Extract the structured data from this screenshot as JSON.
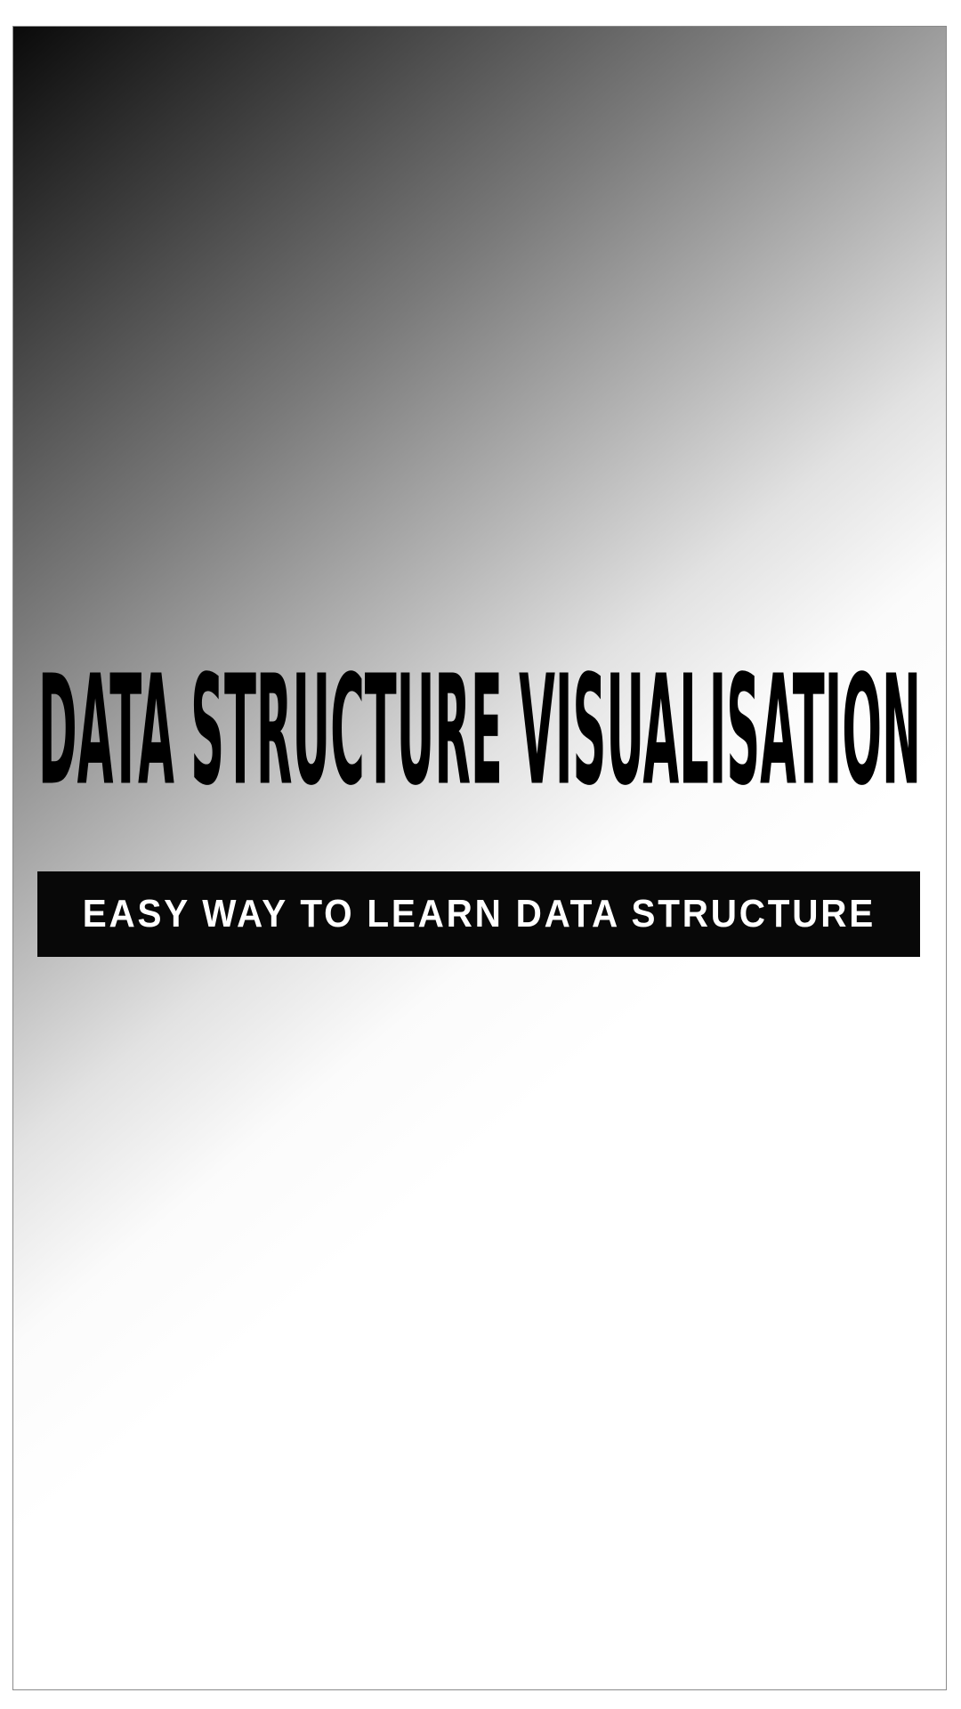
{
  "cover": {
    "title": "DATA STRUCTURE VISUALISATION",
    "tagline": "EASY WAY TO LEARN DATA STRUCTURE"
  },
  "colors": {
    "gradient_dark": "#0a0a0a",
    "background": "#ffffff",
    "title_text": "#000000",
    "tagline_bar": "#080808",
    "tagline_text": "#ffffff"
  }
}
